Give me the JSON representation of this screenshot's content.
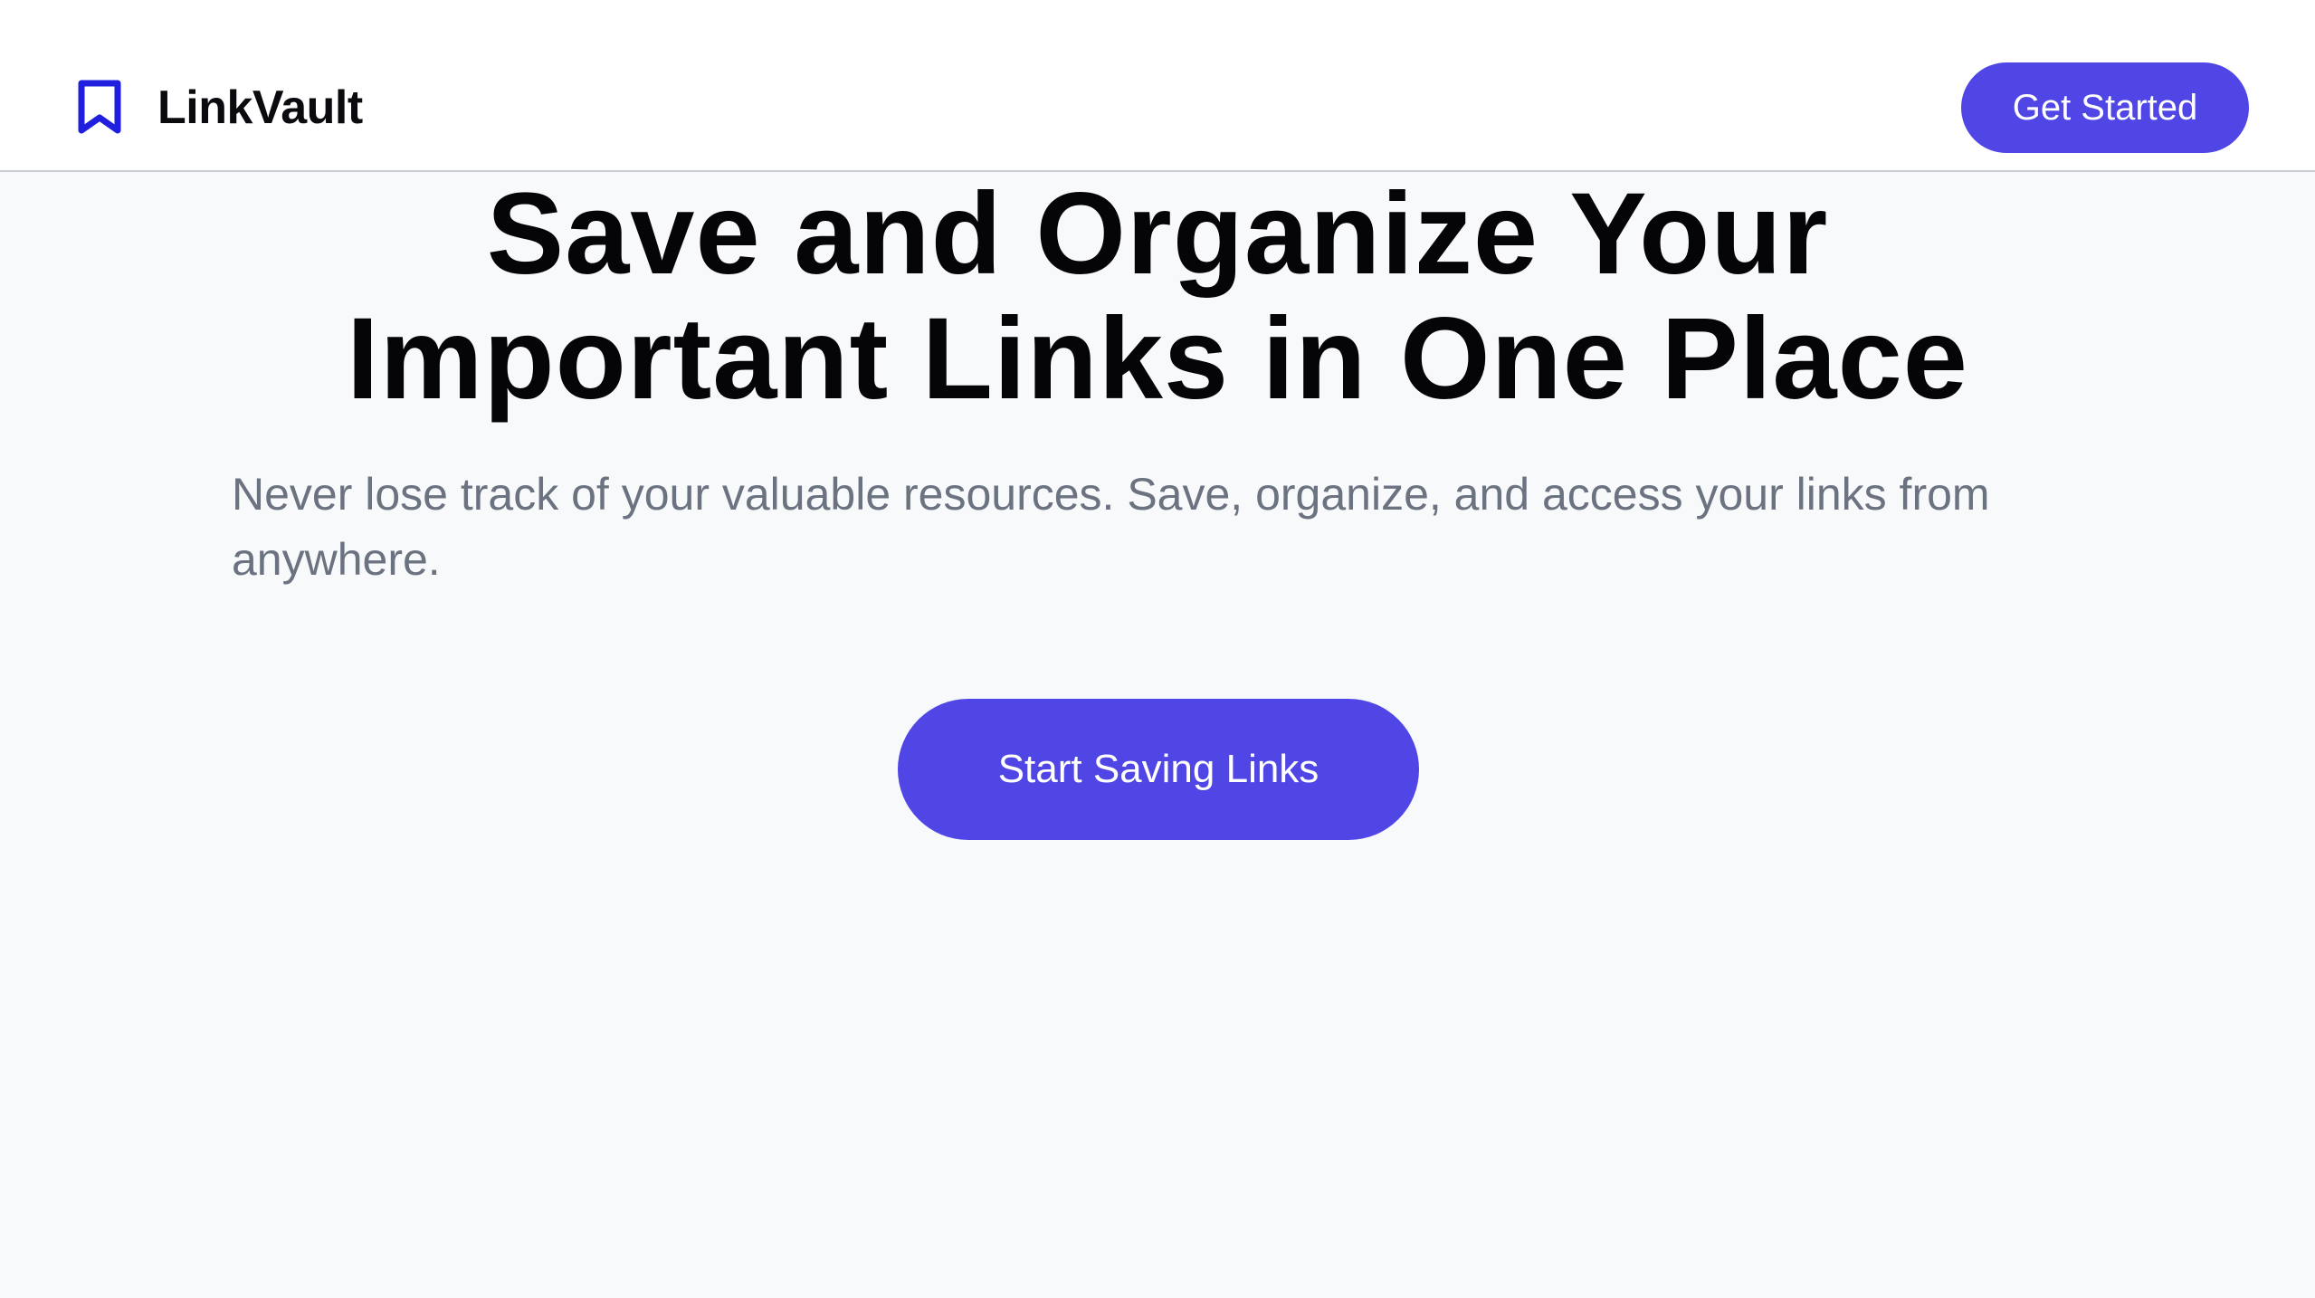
{
  "stray_mark": ".",
  "header": {
    "brand_icon": "bookmark-icon",
    "brand_name": "LinkVault",
    "get_started_label": "Get Started"
  },
  "hero": {
    "title_line_1": "Save and Organize Your",
    "title_line_2": "Important Links in One Place",
    "subtitle": "Never lose track of your valuable resources. Save, organize, and access your links from anywhere.",
    "cta_label": "Start Saving Links"
  },
  "colors": {
    "accent": "#4f46e5",
    "icon_blue": "#1f1fdd",
    "page_background": "#f8f9fb",
    "header_background": "#ffffff",
    "subtitle_gray": "#6b7280"
  }
}
